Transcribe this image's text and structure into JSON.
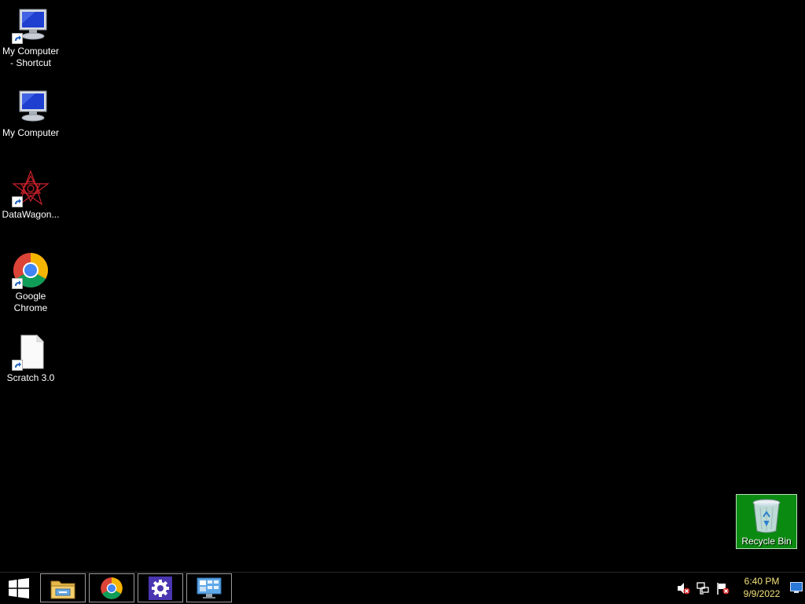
{
  "desktop": {
    "icons": [
      {
        "label": "My Computer\n- Shortcut",
        "icon": "computer-icon",
        "shortcut": true
      },
      {
        "label": "My Computer",
        "icon": "computer-icon",
        "shortcut": false
      },
      {
        "label": "DataWagon...",
        "icon": "datawagon-icon",
        "shortcut": true
      },
      {
        "label": "Google\nChrome",
        "icon": "chrome-icon",
        "shortcut": true
      },
      {
        "label": "Scratch 3.0",
        "icon": "document-icon",
        "shortcut": true
      }
    ],
    "recycle_bin": {
      "label": "Recycle Bin",
      "icon": "recycle-bin-icon"
    }
  },
  "taskbar": {
    "start_icon": "windows-logo-icon",
    "pinned": [
      {
        "name": "File Explorer",
        "icon": "file-explorer-icon"
      },
      {
        "name": "Google Chrome",
        "icon": "chrome-icon"
      },
      {
        "name": "Settings",
        "icon": "gear-icon"
      },
      {
        "name": "Control Panel",
        "icon": "control-panel-icon"
      }
    ],
    "tray": {
      "icons": [
        "speaker-muted-icon",
        "network-icon",
        "action-center-flag-icon"
      ],
      "time": "6:40 PM",
      "date": "9/9/2022"
    }
  },
  "colors": {
    "desktop_bg": "#000000",
    "selection_green": "#0b8a12",
    "clock_text": "#f2e37a"
  }
}
